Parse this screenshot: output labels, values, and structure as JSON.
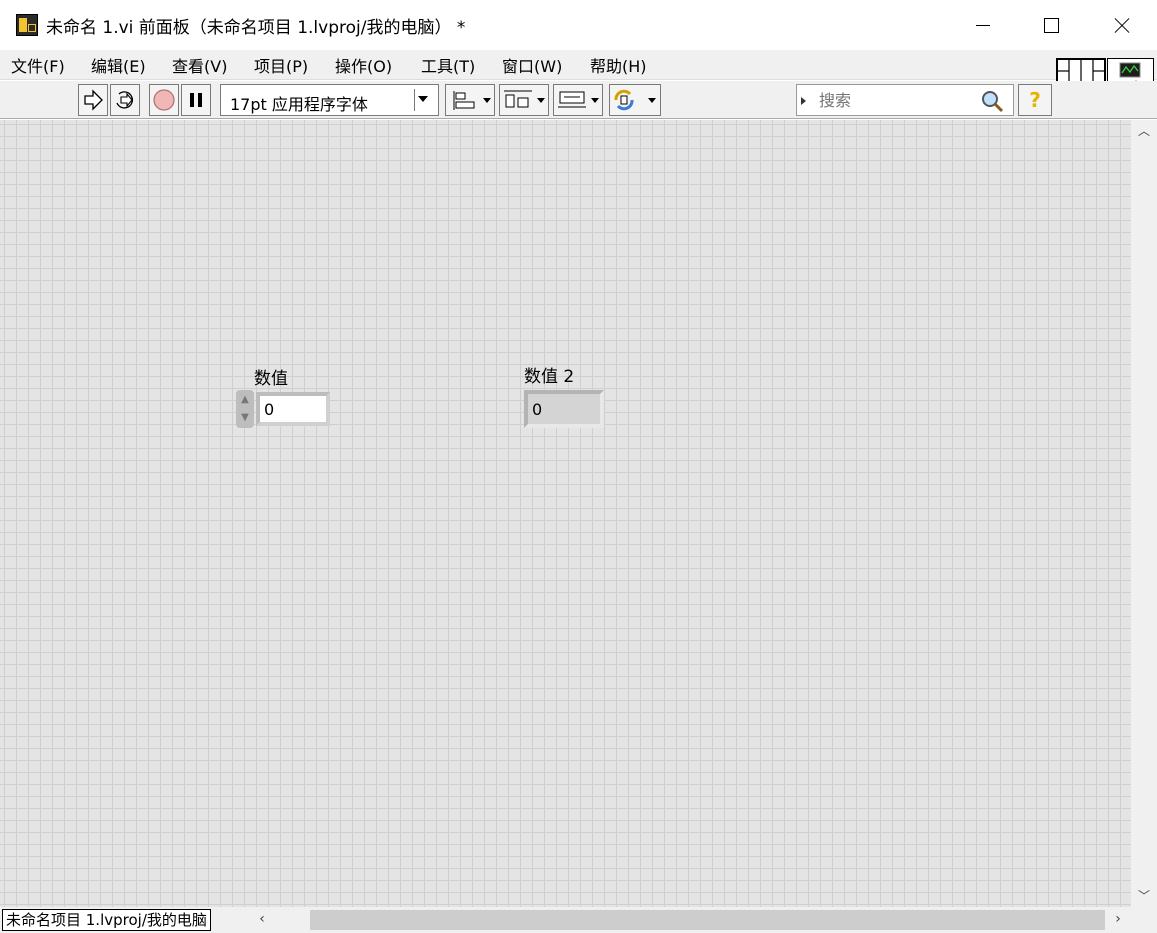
{
  "window": {
    "title": "未命名 1.vi 前面板（未命名项目 1.lvproj/我的电脑） *"
  },
  "menu": [
    {
      "label": "文件(F)"
    },
    {
      "label": "编辑(E)"
    },
    {
      "label": "查看(V)"
    },
    {
      "label": "项目(P)"
    },
    {
      "label": "操作(O)"
    },
    {
      "label": "工具(T)"
    },
    {
      "label": "窗口(W)"
    },
    {
      "label": "帮助(H)"
    }
  ],
  "toolbar": {
    "font_selector": "17pt 应用程序字体",
    "search_placeholder": "搜索",
    "help_glyph": "?"
  },
  "panel": {
    "numeric_control": {
      "label": "数值",
      "value": "0"
    },
    "numeric_indicator": {
      "label": "数值 2",
      "value": "0"
    }
  },
  "status": {
    "context": "未命名项目 1.lvproj/我的电脑"
  },
  "vi_icon": {
    "connector_number": "1"
  }
}
